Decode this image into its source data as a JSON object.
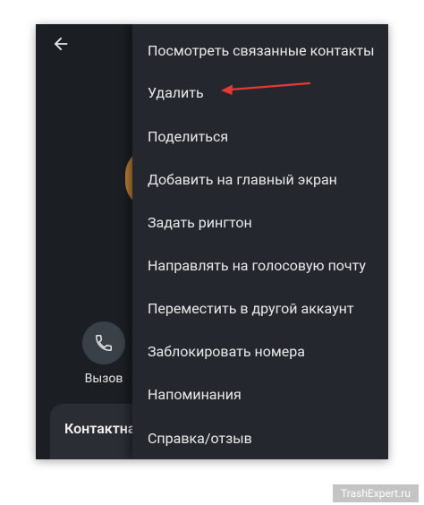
{
  "header": {
    "back_icon": "arrow-left-icon"
  },
  "actions": {
    "call_label": "Вызов",
    "call_icon": "phone-icon"
  },
  "contact_section": {
    "title": "Контактна"
  },
  "menu": {
    "items": [
      {
        "label": "Посмотреть связанные контакты"
      },
      {
        "label": "Удалить"
      },
      {
        "label": "Поделиться"
      },
      {
        "label": "Добавить на главный экран"
      },
      {
        "label": "Задать рингтон"
      },
      {
        "label": "Направлять на голосовую почту"
      },
      {
        "label": "Переместить в другой аккаунт"
      },
      {
        "label": "Заблокировать номера"
      },
      {
        "label": "Напоминания"
      },
      {
        "label": "Справка/отзыв"
      }
    ]
  },
  "annotation": {
    "arrow_color": "#e53935"
  },
  "watermark": {
    "text": "TrashExpert.ru"
  },
  "colors": {
    "screen_bg": "#1b1e22",
    "menu_bg": "#24282e",
    "accent_orange": "#d08a3a"
  }
}
